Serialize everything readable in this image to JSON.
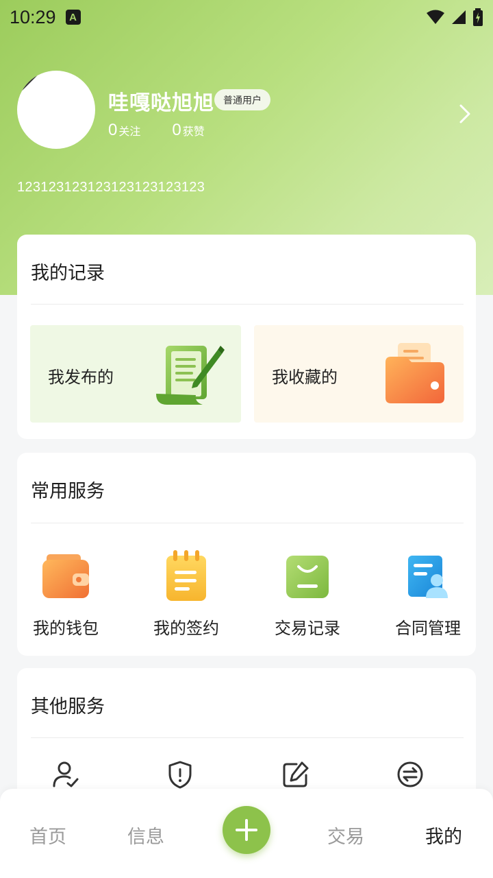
{
  "status_bar": {
    "time": "10:29",
    "notification_icon": "A"
  },
  "profile": {
    "name": "哇嘎哒旭旭",
    "badge": "普通用户",
    "follow_count": "0",
    "follow_label": "关注",
    "likes_count": "0",
    "likes_label": "获赞",
    "bio": "123123123123123123123123"
  },
  "records": {
    "title": "我的记录",
    "published": "我发布的",
    "favorites": "我收藏的"
  },
  "common_services": {
    "title": "常用服务",
    "items": [
      {
        "label": "我的钱包",
        "icon": "wallet-icon"
      },
      {
        "label": "我的签约",
        "icon": "notepad-icon"
      },
      {
        "label": "交易记录",
        "icon": "shopping-bag-icon"
      },
      {
        "label": "合同管理",
        "icon": "contract-icon"
      }
    ]
  },
  "other_services": {
    "title": "其他服务",
    "icons": [
      "user-check-icon",
      "shield-alert-icon",
      "edit-icon",
      "exchange-icon"
    ]
  },
  "tabbar": {
    "home": "首页",
    "messages": "信息",
    "trade": "交易",
    "mine": "我的",
    "active": "mine"
  },
  "colors": {
    "brand_green": "#8dc24b",
    "hero_start": "#9ccc5c",
    "hero_end": "#d8eeb8"
  }
}
